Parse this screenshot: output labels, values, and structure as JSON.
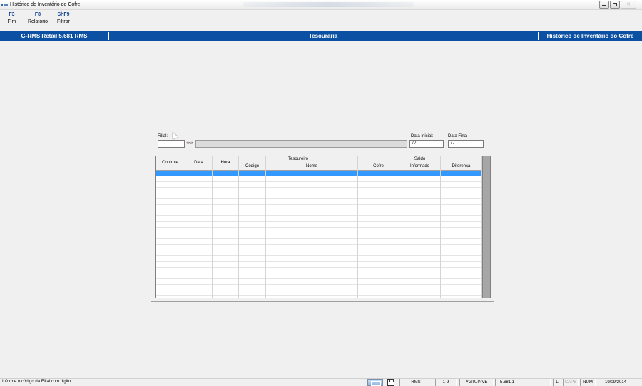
{
  "window": {
    "title": "Histórico de Inventário do Cofre",
    "controls": {
      "minimize_icon": "minimize-icon",
      "maximize_icon": "maximize-icon",
      "close_glyph": "✕"
    }
  },
  "toolbar": {
    "items": [
      {
        "key": "F3",
        "label": "Fim"
      },
      {
        "key": "F8",
        "label": "Relatório"
      },
      {
        "key": "ShF9",
        "label": "Filtrar"
      }
    ]
  },
  "header": {
    "left": "G-RMS Retail 5.681 RMS",
    "center": "Tesouraria",
    "right": "Histórico de Inventário do Cofre",
    "color": "#0c50a3"
  },
  "filter": {
    "filial_label": "Filial:",
    "filial_value": "",
    "filial_name": "",
    "search_icon": "binoculars-icon",
    "binoc_glyph": "👓",
    "data_inicial_label": "Data Inicial:",
    "data_inicial_value": "/ /",
    "data_final_label": "Data Final",
    "data_final_value": "/ /"
  },
  "grid": {
    "columns": {
      "controle": "Controle",
      "data": "Data",
      "hora": "Hora",
      "tesoureiro": "Tesoureiro",
      "codigo": "Código",
      "nome": "Nome",
      "saldo": "Saldo",
      "cofre": "Cofre",
      "informado": "Informado",
      "diferenca": "Diferença"
    },
    "selection_color": "#3399ff"
  },
  "status": {
    "message": "Informe o código da Filial com digito.",
    "cells": [
      "RMS",
      "1-9",
      "VGTUINVE",
      "5.681.1",
      "",
      "L",
      "CAPS",
      "NUM",
      "19/09/2014"
    ]
  }
}
